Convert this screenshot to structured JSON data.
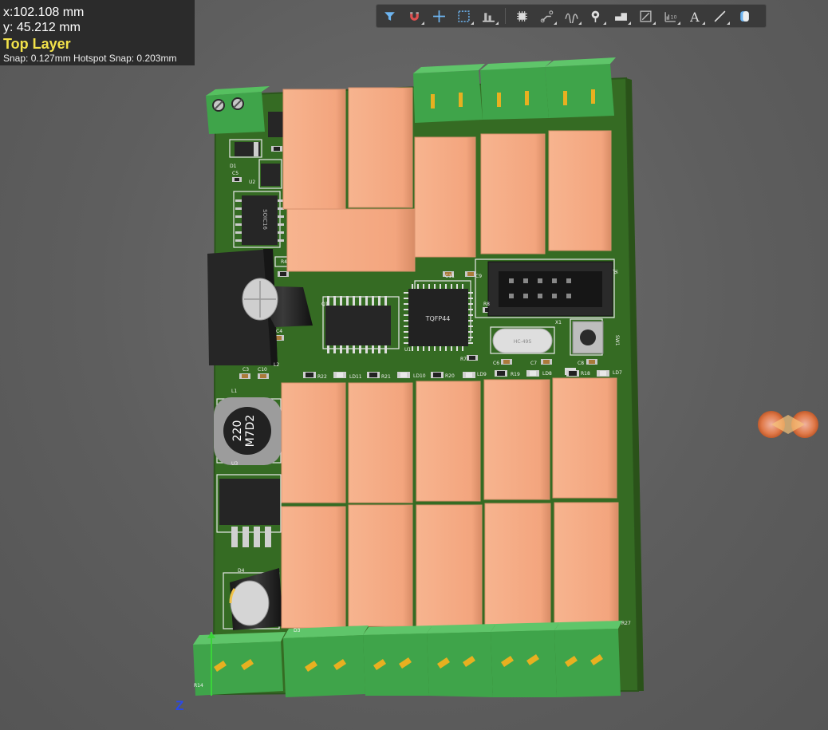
{
  "readout": {
    "x": "x:102.108 mm",
    "y": "y: 45.212  mm",
    "layer": "Top Layer",
    "snap": "Snap: 0.127mm Hotspot Snap: 0.203mm"
  },
  "toolbar": {
    "buttons": [
      {
        "name": "filter-icon"
      },
      {
        "name": "magnet-snap-icon"
      },
      {
        "name": "crosshair-icon"
      },
      {
        "name": "select-rect-icon"
      },
      {
        "name": "align-icon"
      },
      {
        "name": "component-icon"
      },
      {
        "name": "route-icon"
      },
      {
        "name": "diff-pair-icon"
      },
      {
        "name": "via-icon"
      },
      {
        "name": "polygon-icon"
      },
      {
        "name": "region-icon"
      },
      {
        "name": "dimension-icon"
      },
      {
        "name": "text-icon"
      },
      {
        "name": "line-icon"
      },
      {
        "name": "3d-body-icon"
      }
    ]
  },
  "colors": {
    "pcb": "#356b23",
    "relay": "#f3a57e",
    "terminal": "#3fa44a",
    "silk": "#f4f4f4",
    "ic": "#262626"
  },
  "board_labels": {
    "tqfp": "TQFP44",
    "crystal": "HC-49S",
    "inductor_line1": "220",
    "inductor_line2": "M7D2",
    "soic": "SOIC16",
    "d1": "D1",
    "c5": "C5",
    "u2": "U2",
    "r4": "R4",
    "q1": "Q1",
    "c4": "C4",
    "c3": "C3",
    "c10": "C10",
    "l2": "L2",
    "l1": "L1",
    "u3": "U3",
    "d4": "D4",
    "d3": "D3",
    "r1": "R14",
    "c11": "C11",
    "c9": "C9",
    "r8": "R8",
    "r7": "R7",
    "u1": "U1",
    "x1": "X1",
    "sw1": "SW1",
    "c6": "C6",
    "c7": "C7",
    "c8": "C8",
    "r22": "R22",
    "ld11": "LD11",
    "r21": "R21",
    "ld10": "LD10",
    "r20": "R20",
    "ld9": "LD9",
    "r19": "R19",
    "ld8": "LD8",
    "r18": "R18",
    "ld7": "LD7",
    "r27": "R27",
    "j6": "J6"
  },
  "axis_label": "Z"
}
